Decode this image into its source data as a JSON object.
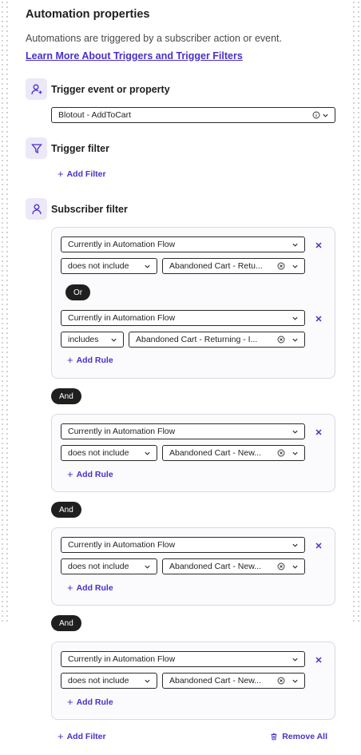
{
  "header": {
    "title": "Automation properties",
    "description": "Automations are triggered by a subscriber action or event.",
    "learn_link": "Learn More About Triggers and Trigger Filters"
  },
  "trigger_event": {
    "label": "Trigger event or property",
    "value": "Blotout - AddToCart"
  },
  "trigger_filter": {
    "label": "Trigger filter",
    "add_label": "Add Filter"
  },
  "subscriber_filter": {
    "label": "Subscriber filter",
    "groups": [
      {
        "rules": [
          {
            "property": "Currently in Automation Flow",
            "operator": "does not include",
            "value": "Abandoned Cart - Retu..."
          },
          {
            "property": "Currently in Automation Flow",
            "operator": "includes",
            "value": "Abandoned Cart - Returning - I..."
          }
        ],
        "joiner": "Or",
        "add_rule": "Add Rule"
      },
      {
        "rules": [
          {
            "property": "Currently in Automation Flow",
            "operator": "does not include",
            "value": "Abandoned Cart - New..."
          }
        ],
        "add_rule": "Add Rule"
      },
      {
        "rules": [
          {
            "property": "Currently in Automation Flow",
            "operator": "does not include",
            "value": "Abandoned Cart - New..."
          }
        ],
        "add_rule": "Add Rule"
      },
      {
        "rules": [
          {
            "property": "Currently in Automation Flow",
            "operator": "does not include",
            "value": "Abandoned Cart - New..."
          }
        ],
        "add_rule": "Add Rule"
      }
    ],
    "group_joiner": "And",
    "add_filter": "Add Filter",
    "remove_all": "Remove All"
  },
  "icons": {
    "trigger_event": "user-plus-icon",
    "trigger_filter": "funnel-icon",
    "subscriber_filter": "user-icon"
  },
  "colors": {
    "accent": "#4b2fc9",
    "icon_bg": "#ece8f8",
    "pill_bg": "#1f1f1f"
  }
}
